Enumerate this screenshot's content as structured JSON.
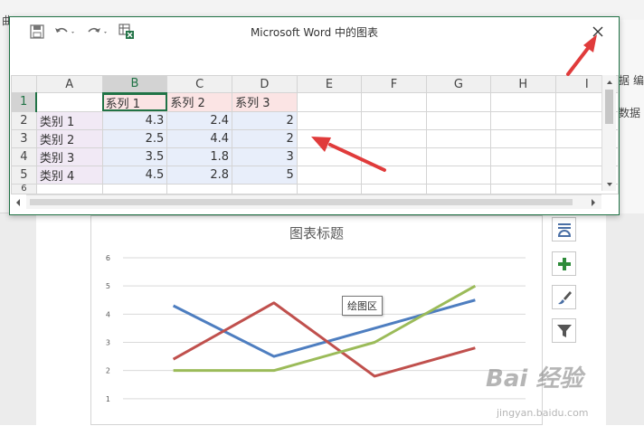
{
  "background_ribbon": {
    "visible_fragments": [
      "曲",
      "据",
      "编",
      "数据"
    ]
  },
  "dialog": {
    "title": "Microsoft Word 中的图表",
    "toolbar": {
      "save_icon": "save-icon",
      "undo_icon": "undo-icon",
      "redo_icon": "redo-icon",
      "excel_icon": "edit-in-excel-icon"
    },
    "close_icon": "close-icon",
    "columns": [
      "A",
      "B",
      "C",
      "D",
      "E",
      "F",
      "G",
      "H",
      "I"
    ],
    "rows": [
      "1",
      "2",
      "3",
      "4",
      "5",
      "6"
    ],
    "sheet": {
      "header_row": [
        "",
        "系列 1",
        "系列 2",
        "系列 3"
      ],
      "data_rows": [
        [
          "类别 1",
          "4.3",
          "2.4",
          "2"
        ],
        [
          "类别 2",
          "2.5",
          "4.4",
          "2"
        ],
        [
          "类别 3",
          "3.5",
          "1.8",
          "3"
        ],
        [
          "类别 4",
          "4.5",
          "2.8",
          "5"
        ]
      ]
    }
  },
  "chart": {
    "tooltip": "绘图区",
    "tools": [
      "chart-layout-icon",
      "add-element-icon",
      "chart-style-icon",
      "chart-filter-icon"
    ]
  },
  "chart_data": {
    "type": "line",
    "title": "图表标题",
    "categories": [
      "类别 1",
      "类别 2",
      "类别 3",
      "类别 4"
    ],
    "series": [
      {
        "values": [
          4.3,
          2.5,
          3.5,
          4.5
        ],
        "color": "#4e7ec0"
      },
      {
        "values": [
          2.4,
          4.4,
          1.8,
          2.8
        ],
        "color": "#c0504d"
      },
      {
        "values": [
          2,
          2,
          3,
          5
        ],
        "color": "#9bbb59"
      }
    ],
    "yticks": [
      1,
      2,
      3,
      4,
      5,
      6
    ],
    "ylim": [
      0,
      6
    ],
    "grid": true
  },
  "watermark": {
    "main": "Bai 经验",
    "sub": "jingyan.baidu.com"
  },
  "colors": {
    "excel_green": "#217346",
    "annotation_arrow": "#e03b3b"
  }
}
